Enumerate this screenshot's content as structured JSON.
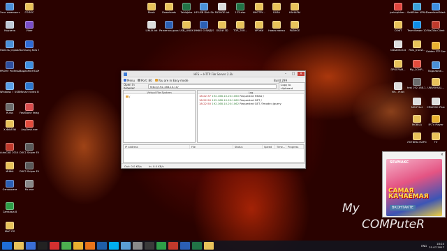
{
  "desktop_icons": [
    {
      "label": "Этот компьютер",
      "icon": "computer-icon",
      "color": "#4a90d9"
    },
    {
      "label": "ГОЛОС",
      "icon": "folder-icon",
      "color": "#e8c25a"
    },
    {
      "label": "Корзина",
      "icon": "recycle-bin-icon",
      "color": "#bfc9d6"
    },
    {
      "label": "Viber",
      "icon": "viber-icon",
      "color": "#7a4ec9"
    },
    {
      "label": "Панель управления",
      "icon": "control-panel-icon",
      "color": "#4a90d9"
    },
    {
      "label": "Samsung Kies 3",
      "icon": "kies-icon",
      "color": "#2e6bd6"
    },
    {
      "label": "PROMT Professional",
      "icon": "promt-icon",
      "color": "#2d4fa0"
    },
    {
      "label": "ВидеоМОНТАЖ",
      "icon": "video-editor-icon",
      "color": "#3d8ee0"
    },
    {
      "label": "Windows 7 USB DVD...",
      "icon": "usb-tool-icon",
      "color": "#5aa0e8"
    },
    {
      "label": "Movavi Video Editor 12",
      "icon": "movavi-icon",
      "color": "#2c77d0"
    },
    {
      "label": "Rufus",
      "icon": "rufus-icon",
      "color": "#6b6b6b"
    },
    {
      "label": "FastStone Image Viewer",
      "icon": "faststone-icon",
      "color": "#d94d4d"
    },
    {
      "label": "Х-ФАЙЛЫ",
      "icon": "folder-icon",
      "color": "#e8c25a"
    },
    {
      "label": "AnyDesk.exe",
      "icon": "anydesk-icon",
      "color": "#e34b3c"
    },
    {
      "label": "AutoCAD 2014 -...",
      "icon": "autocad-icon",
      "color": "#c0392b"
    },
    {
      "label": "DXC1 Sniper Elite 4",
      "icon": "game-icon",
      "color": "#5a5a5a"
    },
    {
      "label": "ИНФА",
      "icon": "folder-icon",
      "color": "#e8c25a"
    },
    {
      "label": "DXC2 Sniper Elite 4",
      "icon": "game-icon",
      "color": "#5a5a5a"
    },
    {
      "label": "Ознакомте",
      "icon": "document-icon",
      "color": "#2b5fb4"
    },
    {
      "label": "Mc.exe",
      "icon": "exe-icon",
      "color": "#888888"
    },
    {
      "label": "Camtasia 8",
      "icon": "camtasia-icon",
      "color": "#2e9e48"
    },
    {
      "label": "MAC OS",
      "icon": "folder-icon",
      "color": "#e8c25a"
    },
    {
      "label": "Music",
      "icon": "folder-icon",
      "color": "#e8c25a"
    },
    {
      "label": "Downloads",
      "icon": "folder-icon",
      "color": "#e8c25a"
    },
    {
      "label": "TableJobs",
      "icon": "excel-icon",
      "color": "#217346"
    },
    {
      "label": "HP USB Disk Storage F...",
      "icon": "usb-icon",
      "color": "#4a90d9"
    },
    {
      "label": "РАЗНОЕ.txt",
      "icon": "text-file-icon",
      "color": "#dddddd"
    },
    {
      "label": "123.xlsx",
      "icon": "excel-icon",
      "color": "#217346"
    },
    {
      "label": "ИНСТРУ...",
      "icon": "folder-icon",
      "color": "#e8c25a"
    },
    {
      "label": "БАЗА",
      "icon": "folder-icon",
      "color": "#e8c25a"
    },
    {
      "label": "КАНАЛЫ",
      "icon": "folder-icon",
      "color": "#e8c25a"
    },
    {
      "label": "LINUX.txt",
      "icon": "text-file-icon",
      "color": "#dddddd"
    },
    {
      "label": "Разметка диска_LINU...",
      "icon": "document-icon",
      "color": "#2b5fb4"
    },
    {
      "label": "USB_LINUX",
      "icon": "folder-icon",
      "color": "#e8c25a"
    },
    {
      "label": "ИНФО О ВИДЕО.docx",
      "icon": "word-icon",
      "color": "#2b5fb4"
    },
    {
      "label": "ОБОИ 3D",
      "icon": "folder-icon",
      "color": "#e8c25a"
    },
    {
      "label": "TOP_TOR...",
      "icon": "folder-icon",
      "color": "#e8c25a"
    },
    {
      "label": "УРОКИ",
      "icon": "folder-icon",
      "color": "#e8c25a"
    },
    {
      "label": "Новая папка",
      "icon": "folder-icon",
      "color": "#e8c25a"
    },
    {
      "label": "РАЗНОЕ",
      "icon": "folder-icon",
      "color": "#e8c25a"
    },
    {
      "label": "jcolorpicker...",
      "icon": "color-picker-icon",
      "color": "#e1463e"
    },
    {
      "label": "SoftEther VPN Clie...",
      "icon": "vpn-icon",
      "color": "#3aa0d8"
    },
    {
      "label": "Download Master",
      "icon": "download-master-icon",
      "color": "#3d8ee0"
    },
    {
      "label": "СОФТ",
      "icon": "folder-icon",
      "color": "#e8c25a"
    },
    {
      "label": "TeamViewer 10",
      "icon": "teamviewer-icon",
      "color": "#0e8ee9"
    },
    {
      "label": "FileZilla Client",
      "icon": "filezilla-icon",
      "color": "#c0392b"
    },
    {
      "label": "CD&DVD.txt",
      "icon": "text-file-icon",
      "color": "#dddddd"
    },
    {
      "label": "Files_transf...",
      "icon": "folder-icon",
      "color": "#e8c25a"
    },
    {
      "label": "ПРОГРАМ...",
      "icon": "folder-icon",
      "color": "#e8c25a"
    },
    {
      "label": "My_COMP...",
      "icon": "my-comp-icon",
      "color": "#e34b3c"
    },
    {
      "label": "Golden FTP Server",
      "icon": "ftp-server-icon",
      "color": "#e8b030"
    },
    {
      "label": "Подключе...",
      "icon": "remote-desktop-icon",
      "color": "#4a90d9"
    },
    {
      "label": "test 192.168.1...",
      "icon": "shortcut-icon",
      "color": "#6b6b6b"
    },
    {
      "label": "UNIVERSAL...",
      "icon": "folder-icon",
      "color": "#e8c25a"
    },
    {
      "label": "hfs - IP.txt",
      "icon": "text-file-icon",
      "color": "#dddddd"
    },
    {
      "label": "NOUT.txt",
      "icon": "text-file-icon",
      "color": "#dddddd"
    },
    {
      "label": "СПИСОК IP.txt",
      "icon": "text-file-icon",
      "color": "#dddddd"
    },
    {
      "label": "MOBILA",
      "icon": "folder-icon",
      "color": "#e8c25a"
    },
    {
      "label": "IP-TV Player",
      "icon": "iptv-icon",
      "color": "#e8b030"
    },
    {
      "label": "ЛОГИНЫ ПАРОЛИ",
      "icon": "folder-icon",
      "color": "#e8c25a"
    },
    {
      "label": "TV",
      "icon": "folder-icon",
      "color": "#e8c25a"
    }
  ],
  "window": {
    "title": "HFS ~ HTTP File Server 2.3k",
    "build": "Build 299",
    "toolbar": {
      "menu": "Menu",
      "port": "Port: 80",
      "mode": "You are in Easy mode"
    },
    "open_in_browser": "Open in browser",
    "url": "http://192.168.10.10/",
    "copy_clipboard": "Copy to clipboard",
    "vfs_header": "Virtual File System",
    "vfs_root": "/",
    "log_header": "Log",
    "log": [
      {
        "time": "18:22:37",
        "ip": "192.168.10.20:1060",
        "msg": "Requested HEAD /"
      },
      {
        "time": "18:22:50",
        "ip": "192.168.10.20:1062",
        "msg": "Requested GET /"
      },
      {
        "time": "18:22:50",
        "ip": "192.168.10.20:1062",
        "msg": "Requested GET /?mode=jquery"
      }
    ],
    "conn_columns": [
      "IP address",
      "File",
      "Status",
      "Speed",
      "Time...",
      "Progress"
    ],
    "status": {
      "out": "Out: 0.0 KB/s",
      "in": "In: 0.0 KB/s"
    }
  },
  "ad": {
    "top_text": "SEVMAKC",
    "big_text": "САМАЯ КАЧАЕМАЯ",
    "vk": "ВКОНТАКТЕ",
    "close": "×"
  },
  "watermark": {
    "line1": "My",
    "line2": "COMPuteR"
  },
  "tray": {
    "lang": "ENG",
    "time": "18:24",
    "date": "21.07.2017"
  },
  "taskbar_apps": [
    {
      "icon": "file-explorer-icon",
      "color": "#e8c25a"
    },
    {
      "icon": "media-player-icon",
      "color": "#3a6fd6"
    },
    {
      "icon": "terminal-icon",
      "color": "#222222"
    },
    {
      "icon": "opera-icon",
      "color": "#d33030"
    },
    {
      "icon": "chrome-icon",
      "color": "#4caf50"
    },
    {
      "icon": "aimp-icon",
      "color": "#e8b030"
    },
    {
      "icon": "firefox-icon",
      "color": "#e8751a"
    },
    {
      "icon": "photoshop-icon",
      "color": "#1f5fa8"
    },
    {
      "icon": "skype-icon",
      "color": "#00aff0"
    },
    {
      "icon": "paint-icon",
      "color": "#5a9fd4"
    },
    {
      "icon": "hfs-icon",
      "color": "#8a8a8a"
    },
    {
      "icon": "calculator-icon",
      "color": "#3a3a3a"
    },
    {
      "icon": "camtasia-icon",
      "color": "#2e9e48"
    },
    {
      "icon": "filezilla-icon",
      "color": "#c0392b"
    },
    {
      "icon": "word-icon",
      "color": "#2b5fb4"
    },
    {
      "icon": "excel-icon",
      "color": "#217346"
    },
    {
      "icon": "folder-icon",
      "color": "#e8c25a"
    }
  ]
}
